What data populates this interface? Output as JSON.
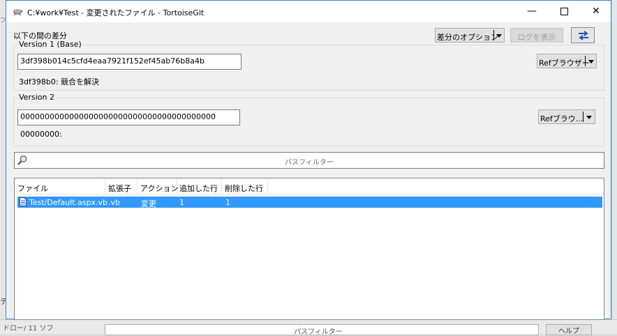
{
  "window": {
    "title": "C:¥work¥Test - 変更されたファイル - TortoiseGit"
  },
  "header": {
    "diff_between_label": "以下の間の差分",
    "diff_options_button": "差分のオプション",
    "show_log_button": "ログを表示"
  },
  "version1": {
    "legend": "Version 1 (Base)",
    "hash_value": "3df398b014c5cfd4eaa7921f152ef45ab76b8a4b",
    "commit_message": "3df398b0: 競合を解決",
    "ref_browser_button": "Refブラウザー"
  },
  "version2": {
    "legend": "Version 2",
    "hash_value": "0000000000000000000000000000000000000000",
    "commit_message": "00000000:",
    "ref_browser_button": "Refブラウ..."
  },
  "filter": {
    "placeholder": "パスフィルター"
  },
  "file_list": {
    "columns": [
      "ファイル",
      "拡張子",
      "アクション",
      "追加した行",
      "削除した行"
    ],
    "rows": [
      {
        "file": "Test/Default.aspx.vb",
        "extension": ".vb",
        "action": "変更",
        "added": "1",
        "deleted": "1"
      }
    ]
  },
  "background": {
    "left_glyph_top": "フ",
    "left_glyph_mid": "テ",
    "bottom_text": "ドロー/ 11 ソフ",
    "bottom_filter": "パスフィルター",
    "bottom_button": "ヘルプ"
  }
}
